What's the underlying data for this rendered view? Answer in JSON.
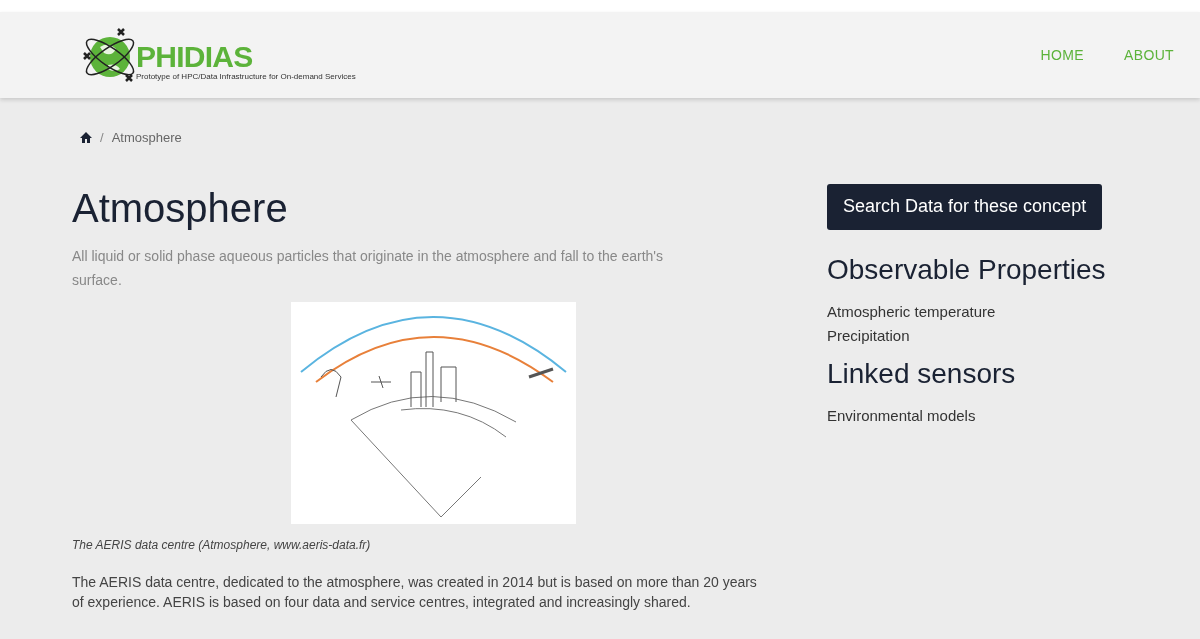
{
  "logo": {
    "name": "PHIDIAS",
    "tagline": "Prototype of HPC/Data Infrastructure for On-demand Services"
  },
  "nav": [
    {
      "label": "HOME"
    },
    {
      "label": "ABOUT"
    }
  ],
  "breadcrumb": {
    "separator": "/",
    "current": "Atmosphere"
  },
  "title": "Atmosphere",
  "description": "All liquid or solid phase aqueous particles that originate in the atmosphere and fall to the earth's surface.",
  "figure_caption": "The AERIS data centre (Atmosphere, www.aeris-data.fr)",
  "body_text": "The AERIS data centre, dedicated to the atmosphere, was created in 2014 but is based on more than 20 years of experience. AERIS is based on four data and service centres, integrated and increasingly shared.",
  "search_button": "Search Data for these concept",
  "sections": [
    {
      "heading": "Observable Properties",
      "items": [
        "Atmospheric temperature",
        "Precipitation"
      ]
    },
    {
      "heading": "Linked sensors",
      "items": [
        "Environmental models"
      ]
    }
  ]
}
